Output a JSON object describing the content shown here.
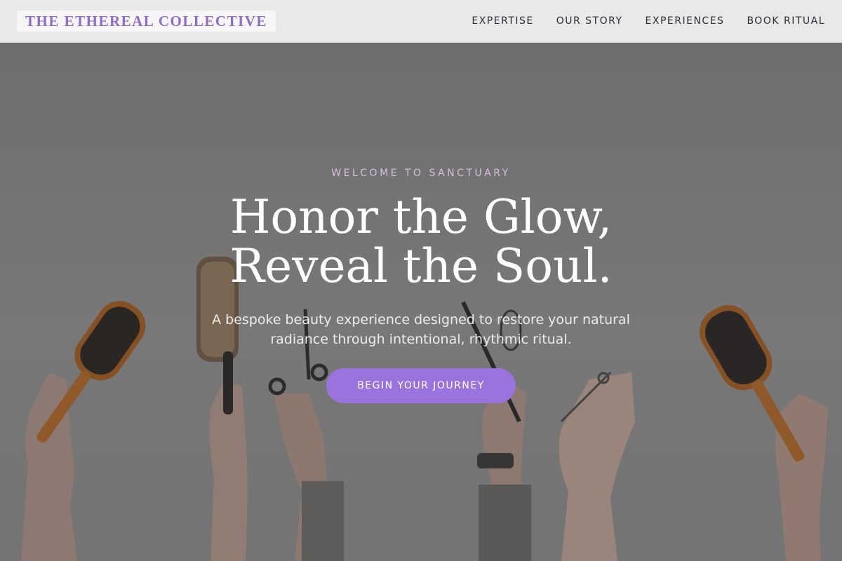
{
  "brand": {
    "name": "THE ETHEREAL COLLECTIVE"
  },
  "nav": {
    "links": [
      {
        "label": "EXPERTISE"
      },
      {
        "label": "OUR STORY"
      },
      {
        "label": "EXPERIENCES"
      },
      {
        "label": "BOOK RITUAL"
      }
    ]
  },
  "hero": {
    "eyebrow": "WELCOME TO SANCTUARY",
    "headline_line1": "Honor the Glow,",
    "headline_line2": "Reveal the Soul.",
    "subtext_line1": "A bespoke beauty experience designed to restore your natural",
    "subtext_line2": "radiance through intentional, rhythmic ritual.",
    "cta_label": "BEGIN YOUR JOURNEY",
    "background_description_icon": "hands-holding-hair-tools-photo"
  },
  "colors": {
    "brand_accent": "#8f6bd1",
    "cta_background": "#9a73dd",
    "eyebrow_text": "#d7bfe0",
    "nav_background": "#e9e9e9"
  }
}
